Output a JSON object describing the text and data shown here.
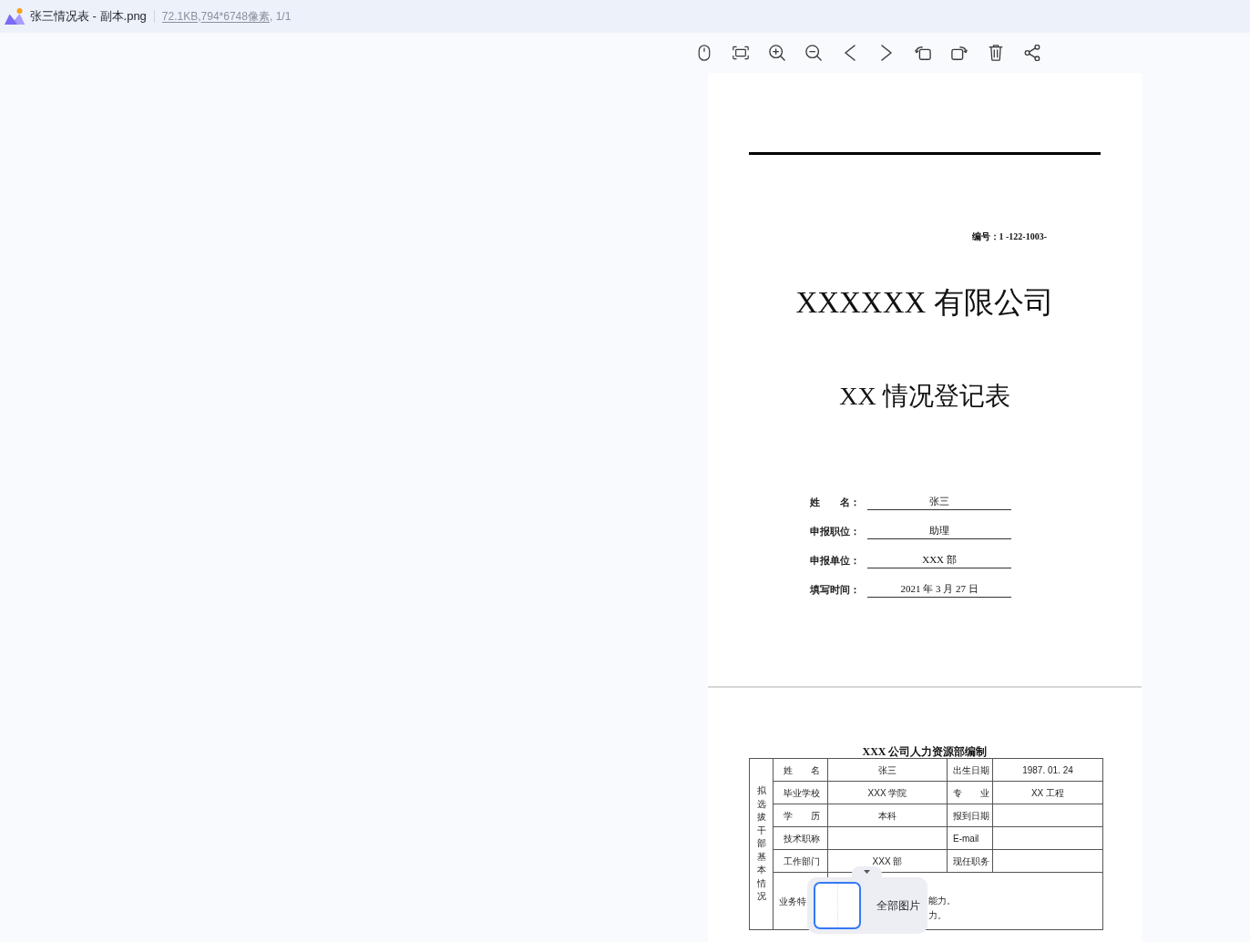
{
  "title_bar": {
    "file_name": "张三情况表 - 副本.png",
    "info": [
      {
        "text": "72.1KB",
        "underlined": true
      },
      {
        "text": ",",
        "underlined": false
      },
      {
        "text": "794*6748像素",
        "underlined": true
      },
      {
        "text": ", 1/1",
        "underlined": false
      }
    ]
  },
  "cover_page": {
    "serial": "编号：1 -122-1003-",
    "company": "XXXXXX 有限公司",
    "form_title": "XX 情况登记表",
    "fields": [
      {
        "label": "姓　　名：",
        "value": "张三"
      },
      {
        "label": "申报职位：",
        "value": "助理"
      },
      {
        "label": "申报单位：",
        "value": "XXX 部"
      },
      {
        "label": "填写时间：",
        "value": "2021 年 3 月 27 日"
      }
    ]
  },
  "table_page": {
    "caption": "XXX 公司人力资源部编制",
    "side_label": "拟选拔干部基本情况",
    "rows": [
      [
        {
          "kind": "label",
          "text": "姓　　名"
        },
        {
          "kind": "value",
          "text": "张三"
        },
        {
          "kind": "label",
          "text": "出生日期"
        },
        {
          "kind": "value",
          "text": "1987. 01. 24"
        }
      ],
      [
        {
          "kind": "label",
          "text": "毕业学校"
        },
        {
          "kind": "value",
          "text": "XXX 学院"
        },
        {
          "kind": "label",
          "text": "专　　业"
        },
        {
          "kind": "value",
          "text": "XX 工程"
        }
      ],
      [
        {
          "kind": "label",
          "text": "学　　历"
        },
        {
          "kind": "value",
          "text": "本科"
        },
        {
          "kind": "label",
          "text": "报到日期"
        },
        {
          "kind": "value"
        }
      ],
      [
        {
          "kind": "label",
          "text": "技术职称"
        },
        {
          "kind": "value"
        },
        {
          "kind": "label",
          "text": "E-mail"
        },
        {
          "kind": "value"
        }
      ],
      [
        {
          "kind": "label",
          "text": "工作部门"
        },
        {
          "kind": "value",
          "text": "XXX 部"
        },
        {
          "kind": "label",
          "text": "现任职务"
        },
        {
          "kind": "value"
        }
      ]
    ],
    "remark": {
      "label": "业务特",
      "lines": [
        "能力。",
        "力。"
      ]
    }
  },
  "all_images": {
    "label": "全部图片",
    "thumbnail": {
      "selected": true
    }
  }
}
